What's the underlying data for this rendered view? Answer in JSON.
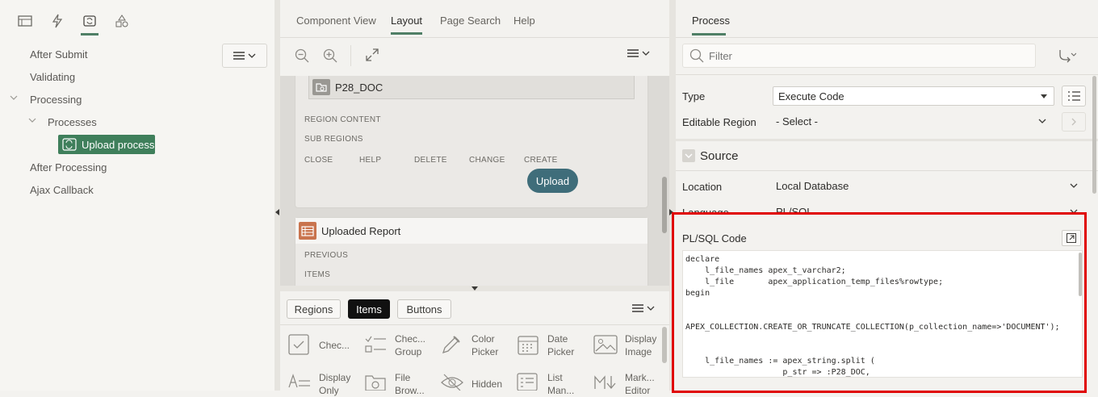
{
  "left_pane": {
    "tabs": [
      "rendering-tab",
      "dynamic-actions-tab",
      "processing-tab",
      "shared-components-tab"
    ],
    "tree": [
      {
        "label": "After Submit",
        "level": 0
      },
      {
        "label": "Validating",
        "level": 0
      },
      {
        "label": "Processing",
        "level": 0,
        "expanded": true
      },
      {
        "label": "Processes",
        "level": 1,
        "expanded": true
      },
      {
        "label": "Upload process",
        "level": 2,
        "selected": true
      },
      {
        "label": "After Processing",
        "level": 0
      },
      {
        "label": "Ajax Callback",
        "level": 0
      }
    ]
  },
  "middle_pane": {
    "tabs": [
      {
        "label": "Component View"
      },
      {
        "label": "Layout",
        "active": true
      },
      {
        "label": "Page Search"
      },
      {
        "label": "Help"
      }
    ],
    "layout": {
      "region1": {
        "title": "P28_DOC",
        "slots": [
          "REGION CONTENT",
          "SUB REGIONS"
        ],
        "button_positions": [
          "CLOSE",
          "HELP",
          "DELETE",
          "CHANGE",
          "CREATE"
        ],
        "button": "Upload"
      },
      "region2": {
        "title": "Uploaded Report",
        "slots": [
          "PREVIOUS",
          "ITEMS"
        ]
      }
    },
    "gallery": {
      "tabs": [
        {
          "label": "Regions"
        },
        {
          "label": "Items",
          "active": true
        },
        {
          "label": "Buttons"
        }
      ],
      "items": [
        {
          "label": "Chec...",
          "icon": "checkbox-icon"
        },
        {
          "label": "Chec... Group",
          "icon": "checkbox-group-icon"
        },
        {
          "label": "Color Picker",
          "icon": "color-picker-icon"
        },
        {
          "label": "Date Picker",
          "icon": "date-picker-icon"
        },
        {
          "label": "Display Image",
          "icon": "display-image-icon"
        },
        {
          "label": "Display Only",
          "icon": "display-only-icon"
        },
        {
          "label": "File Brow...",
          "icon": "file-browse-icon"
        },
        {
          "label": "Hidden",
          "icon": "hidden-icon"
        },
        {
          "label": "List Man...",
          "icon": "list-manager-icon"
        },
        {
          "label": "Mark... Editor",
          "icon": "markdown-editor-icon"
        }
      ]
    }
  },
  "right_pane": {
    "tab": "Process",
    "filter_placeholder": "Filter",
    "type_label": "Type",
    "type_value": "Execute Code",
    "editable_region_label": "Editable Region",
    "editable_region_value": "- Select -",
    "source_heading": "Source",
    "location_label": "Location",
    "location_value": "Local Database",
    "language_label": "Language",
    "language_value": "PL/SQL",
    "code_label": "PL/SQL Code",
    "code_lines": [
      "declare",
      "    l_file_names apex_t_varchar2;",
      "    l_file       apex_application_temp_files%rowtype;",
      "begin",
      "",
      "",
      "APEX_COLLECTION.CREATE_OR_TRUNCATE_COLLECTION(p_collection_name=>'DOCUMENT');",
      "",
      "",
      "    l_file_names := apex_string.split (",
      "                    p_str => :P28_DOC,"
    ]
  },
  "colors": {
    "accent_green": "#4f7f66",
    "selected_node": "#3f7f5b",
    "upload_button": "#3f6d7a",
    "highlight_red": "#e00000"
  }
}
